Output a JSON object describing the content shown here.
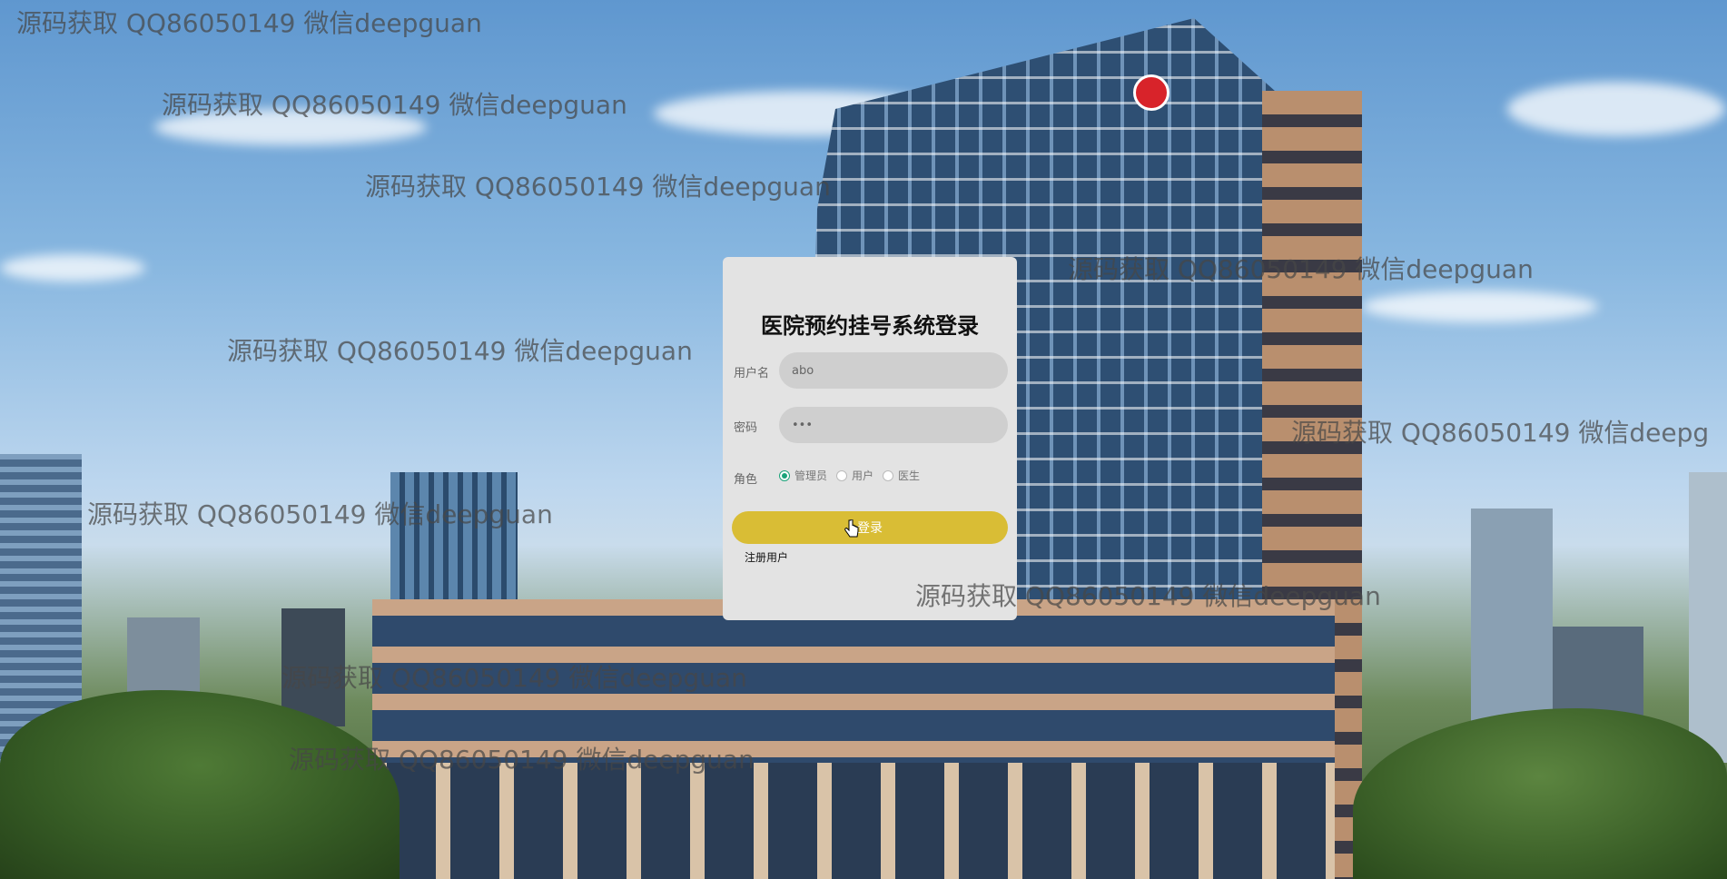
{
  "login": {
    "title": "医院预约挂号系统登录",
    "username_label": "用户名",
    "username_value": "abo",
    "password_label": "密码",
    "password_value": "•••",
    "role_label": "角色",
    "roles": [
      "管理员",
      "用户",
      "医生"
    ],
    "selected_role": "管理员",
    "login_button": "登录",
    "register_link": "注册用户"
  },
  "watermarks": [
    "源码获取 QQ86050149 微信deepguan",
    "源码获取 QQ86050149 微信deepguan",
    "源码获取 QQ86050149 微信deepguan",
    "源码获取 QQ86050149 微信deepguan",
    "源码获取 QQ86050149 微信deepguan",
    "源码获取 QQ86050149 微信deepg",
    "源码获取 QQ86050149 微信deepguan",
    "源码获取 QQ86050149 微信deepguan",
    "源码获取 QQ86050149 微信deepguan",
    "源码获取 QQ86050149 微信deepguan"
  ],
  "colors": {
    "button": "#d9bd35",
    "radio_selected": "#1aa37a",
    "card_bg": "#e3e3e3"
  }
}
